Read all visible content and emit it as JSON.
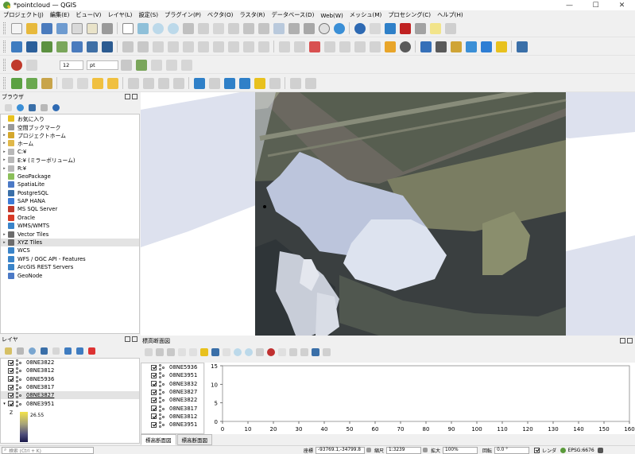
{
  "window": {
    "title": "*pointcloud — QGIS",
    "controls": [
      "—",
      "☐",
      "✕"
    ]
  },
  "menu": [
    "プロジェクト(J)",
    "編集(E)",
    "ビュー(V)",
    "レイヤ(L)",
    "設定(S)",
    "プラグイン(P)",
    "ベクタ(O)",
    "ラスタ(R)",
    "データベース(D)",
    "Web(W)",
    "メッシュ(M)",
    "プロセシング(C)",
    "ヘルプ(H)"
  ],
  "toolbar3": {
    "font_size": "12",
    "unit": "pt"
  },
  "browser": {
    "title": "ブラウザ",
    "items": [
      {
        "label": "お気に入り",
        "arrow": "",
        "color": "#e8c11e"
      },
      {
        "label": "空間ブックマーク",
        "arrow": "▸",
        "color": "#9a9a9a"
      },
      {
        "label": "プロジェクトホーム",
        "arrow": "▸",
        "color": "#d4a72c"
      },
      {
        "label": "ホーム",
        "arrow": "▸",
        "color": "#e0b84a"
      },
      {
        "label": "C:¥",
        "arrow": "▸",
        "color": "#b8b8b8"
      },
      {
        "label": "E:¥ (ミラーボリューム)",
        "arrow": "▸",
        "color": "#b8b8b8"
      },
      {
        "label": "R:¥",
        "arrow": "▸",
        "color": "#b8b8b8"
      },
      {
        "label": "GeoPackage",
        "arrow": "",
        "color": "#8bbf5a"
      },
      {
        "label": "SpatiaLite",
        "arrow": "",
        "color": "#4b79c6"
      },
      {
        "label": "PostgreSQL",
        "arrow": "",
        "color": "#3a6fa8"
      },
      {
        "label": "SAP HANA",
        "arrow": "",
        "color": "#3d7bd6"
      },
      {
        "label": "MS SQL Server",
        "arrow": "",
        "color": "#c0392b"
      },
      {
        "label": "Oracle",
        "arrow": "",
        "color": "#d83a26"
      },
      {
        "label": "WMS/WMTS",
        "arrow": "",
        "color": "#3a84c9"
      },
      {
        "label": "Vector Tiles",
        "arrow": "▸",
        "color": "#6c6c6c"
      },
      {
        "label": "XYZ Tiles",
        "arrow": "▸",
        "color": "#6c6c6c"
      },
      {
        "label": "WCS",
        "arrow": "",
        "color": "#3a84c9"
      },
      {
        "label": "WFS / OGC API - Features",
        "arrow": "",
        "color": "#3a84c9"
      },
      {
        "label": "ArcGIS REST Servers",
        "arrow": "",
        "color": "#3a84c9"
      },
      {
        "label": "GeoNode",
        "arrow": "",
        "color": "#4b79c6"
      }
    ]
  },
  "layers": {
    "title": "レイヤ",
    "items": [
      "08NE3822",
      "08NE3812",
      "08NE5936",
      "08NE3817",
      "08NE3827",
      "08NE3951"
    ],
    "legend": {
      "axis": "Z",
      "value": "26.55"
    }
  },
  "profile": {
    "title": "標高断面図",
    "layers": [
      "08NE5936",
      "08NE3951",
      "08NE3832",
      "08NE3827",
      "08NE3822",
      "08NE3817",
      "08NE3812",
      "08NE3951"
    ],
    "tabs": [
      "標高断面図",
      "標高断面図"
    ]
  },
  "chart_data": {
    "type": "line",
    "title": "",
    "xlabel": "",
    "ylabel": "",
    "xlim": [
      0,
      160
    ],
    "ylim": [
      0,
      15
    ],
    "xticks": [
      0,
      10,
      20,
      30,
      40,
      50,
      60,
      70,
      80,
      90,
      100,
      110,
      120,
      130,
      140,
      150,
      160
    ],
    "yticks": [
      0,
      5,
      10,
      15
    ],
    "series": []
  },
  "status": {
    "search_placeholder": "検索 (Ctrl + K)",
    "coord_label": "座標",
    "coord": "-93769.1,-34799.8",
    "scale_label": "縮尺",
    "scale": "1:3239",
    "mag_label": "拡大",
    "mag": "100%",
    "rot_label": "回転",
    "rot": "0.0 °",
    "render_label": "レンダ",
    "crs": "EPSG:6676"
  }
}
